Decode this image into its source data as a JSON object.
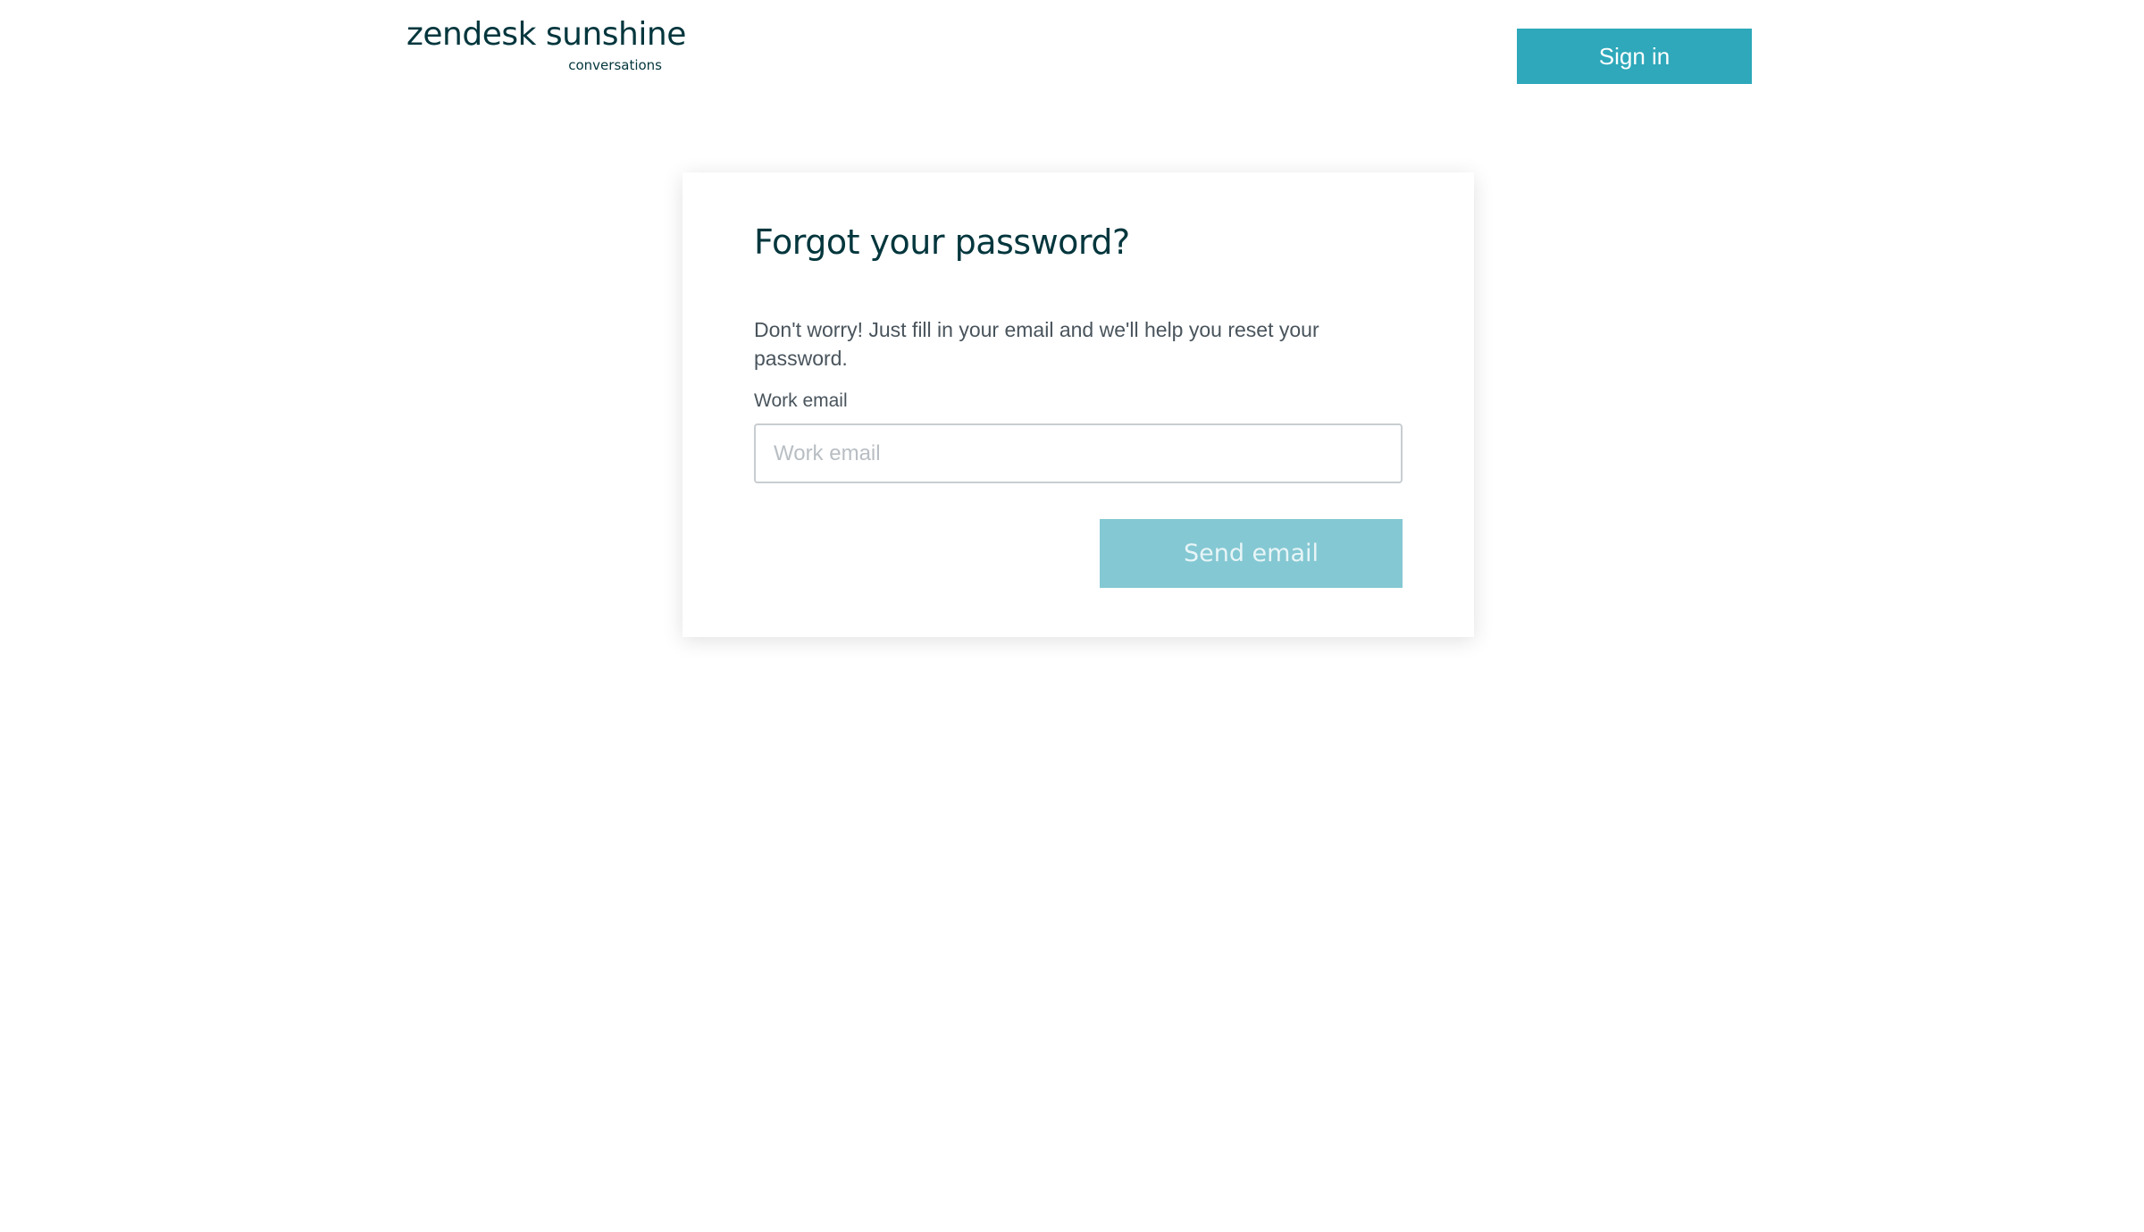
{
  "header": {
    "logo_main": "zendesk sunshine",
    "logo_sub": "conversations",
    "signin_label": "Sign in"
  },
  "card": {
    "title": "Forgot your password?",
    "description": "Don't worry! Just fill in your email and we'll help you reset your password.",
    "email_label": "Work email",
    "email_placeholder": "Work email",
    "email_value": "",
    "send_label": "Send email"
  },
  "colors": {
    "brand_dark": "#03363d",
    "accent": "#2ea8ba",
    "accent_disabled": "#84c8d3",
    "body_text": "#49545c"
  }
}
